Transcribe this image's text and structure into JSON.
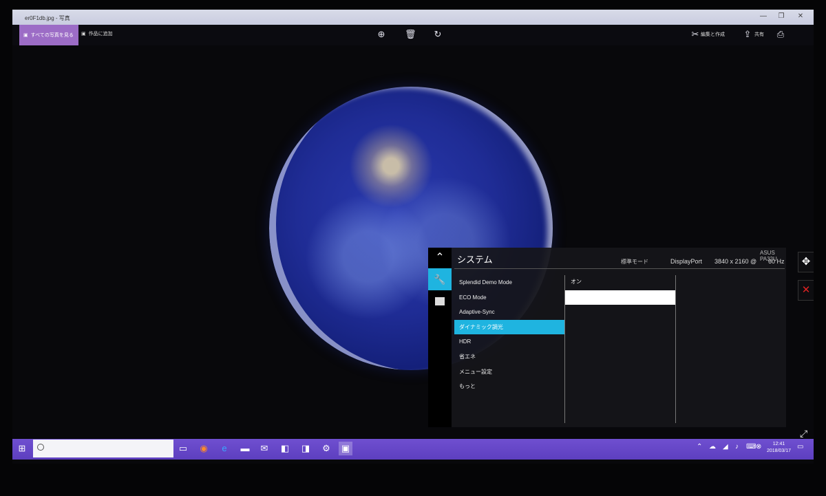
{
  "window": {
    "title": "er0F1db.jpg - 写真",
    "minimize": "—",
    "maximize": "❐",
    "close": "✕"
  },
  "commandbar": {
    "see_all_label": "すべての写真を見る",
    "add_to_creation_label": "作品に追加",
    "zoom_icon": "zoom-in-icon",
    "delete_icon": "trash-icon",
    "rotate_icon": "rotate-icon",
    "edit_create_label": "編集と作成",
    "share_label": "共有",
    "print_icon": "printer-icon"
  },
  "osd": {
    "section_title": "システム",
    "mode_label": "標準モード",
    "input_label": "DisplayPort",
    "resolution": "3840 x 2160 @",
    "refresh": "60 Hz",
    "model": "ASUS PA32U",
    "menu_items": [
      "Splendid Demo Mode",
      "ECO Mode",
      "Adaptive-Sync",
      "ダイナミック調光",
      "HDR",
      "省エネ",
      "メニュー設定",
      "もっと"
    ],
    "selected_index": 3,
    "submenu_options": [
      "オン",
      ""
    ],
    "submenu_selected_index": 1
  },
  "taskbar": {
    "clock_time": "12:41",
    "clock_date": "2018/03/17"
  },
  "colors": {
    "taskbar": "#6f4fd0",
    "osd_accent": "#1fb4e0",
    "see_all_button": "#9c6cc6"
  }
}
